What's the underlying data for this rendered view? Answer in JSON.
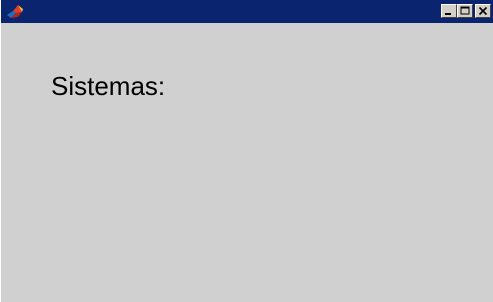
{
  "window": {
    "title": "",
    "icon": "matlab-logo-icon",
    "controls": {
      "minimize": "minimize-icon",
      "maximize": "maximize-icon",
      "close": "close-icon"
    }
  },
  "content": {
    "label": "Sistemas:"
  },
  "colors": {
    "titlebar": "#0a2470",
    "client_background": "#d0d0d0",
    "button_face": "#d4d0c8"
  }
}
